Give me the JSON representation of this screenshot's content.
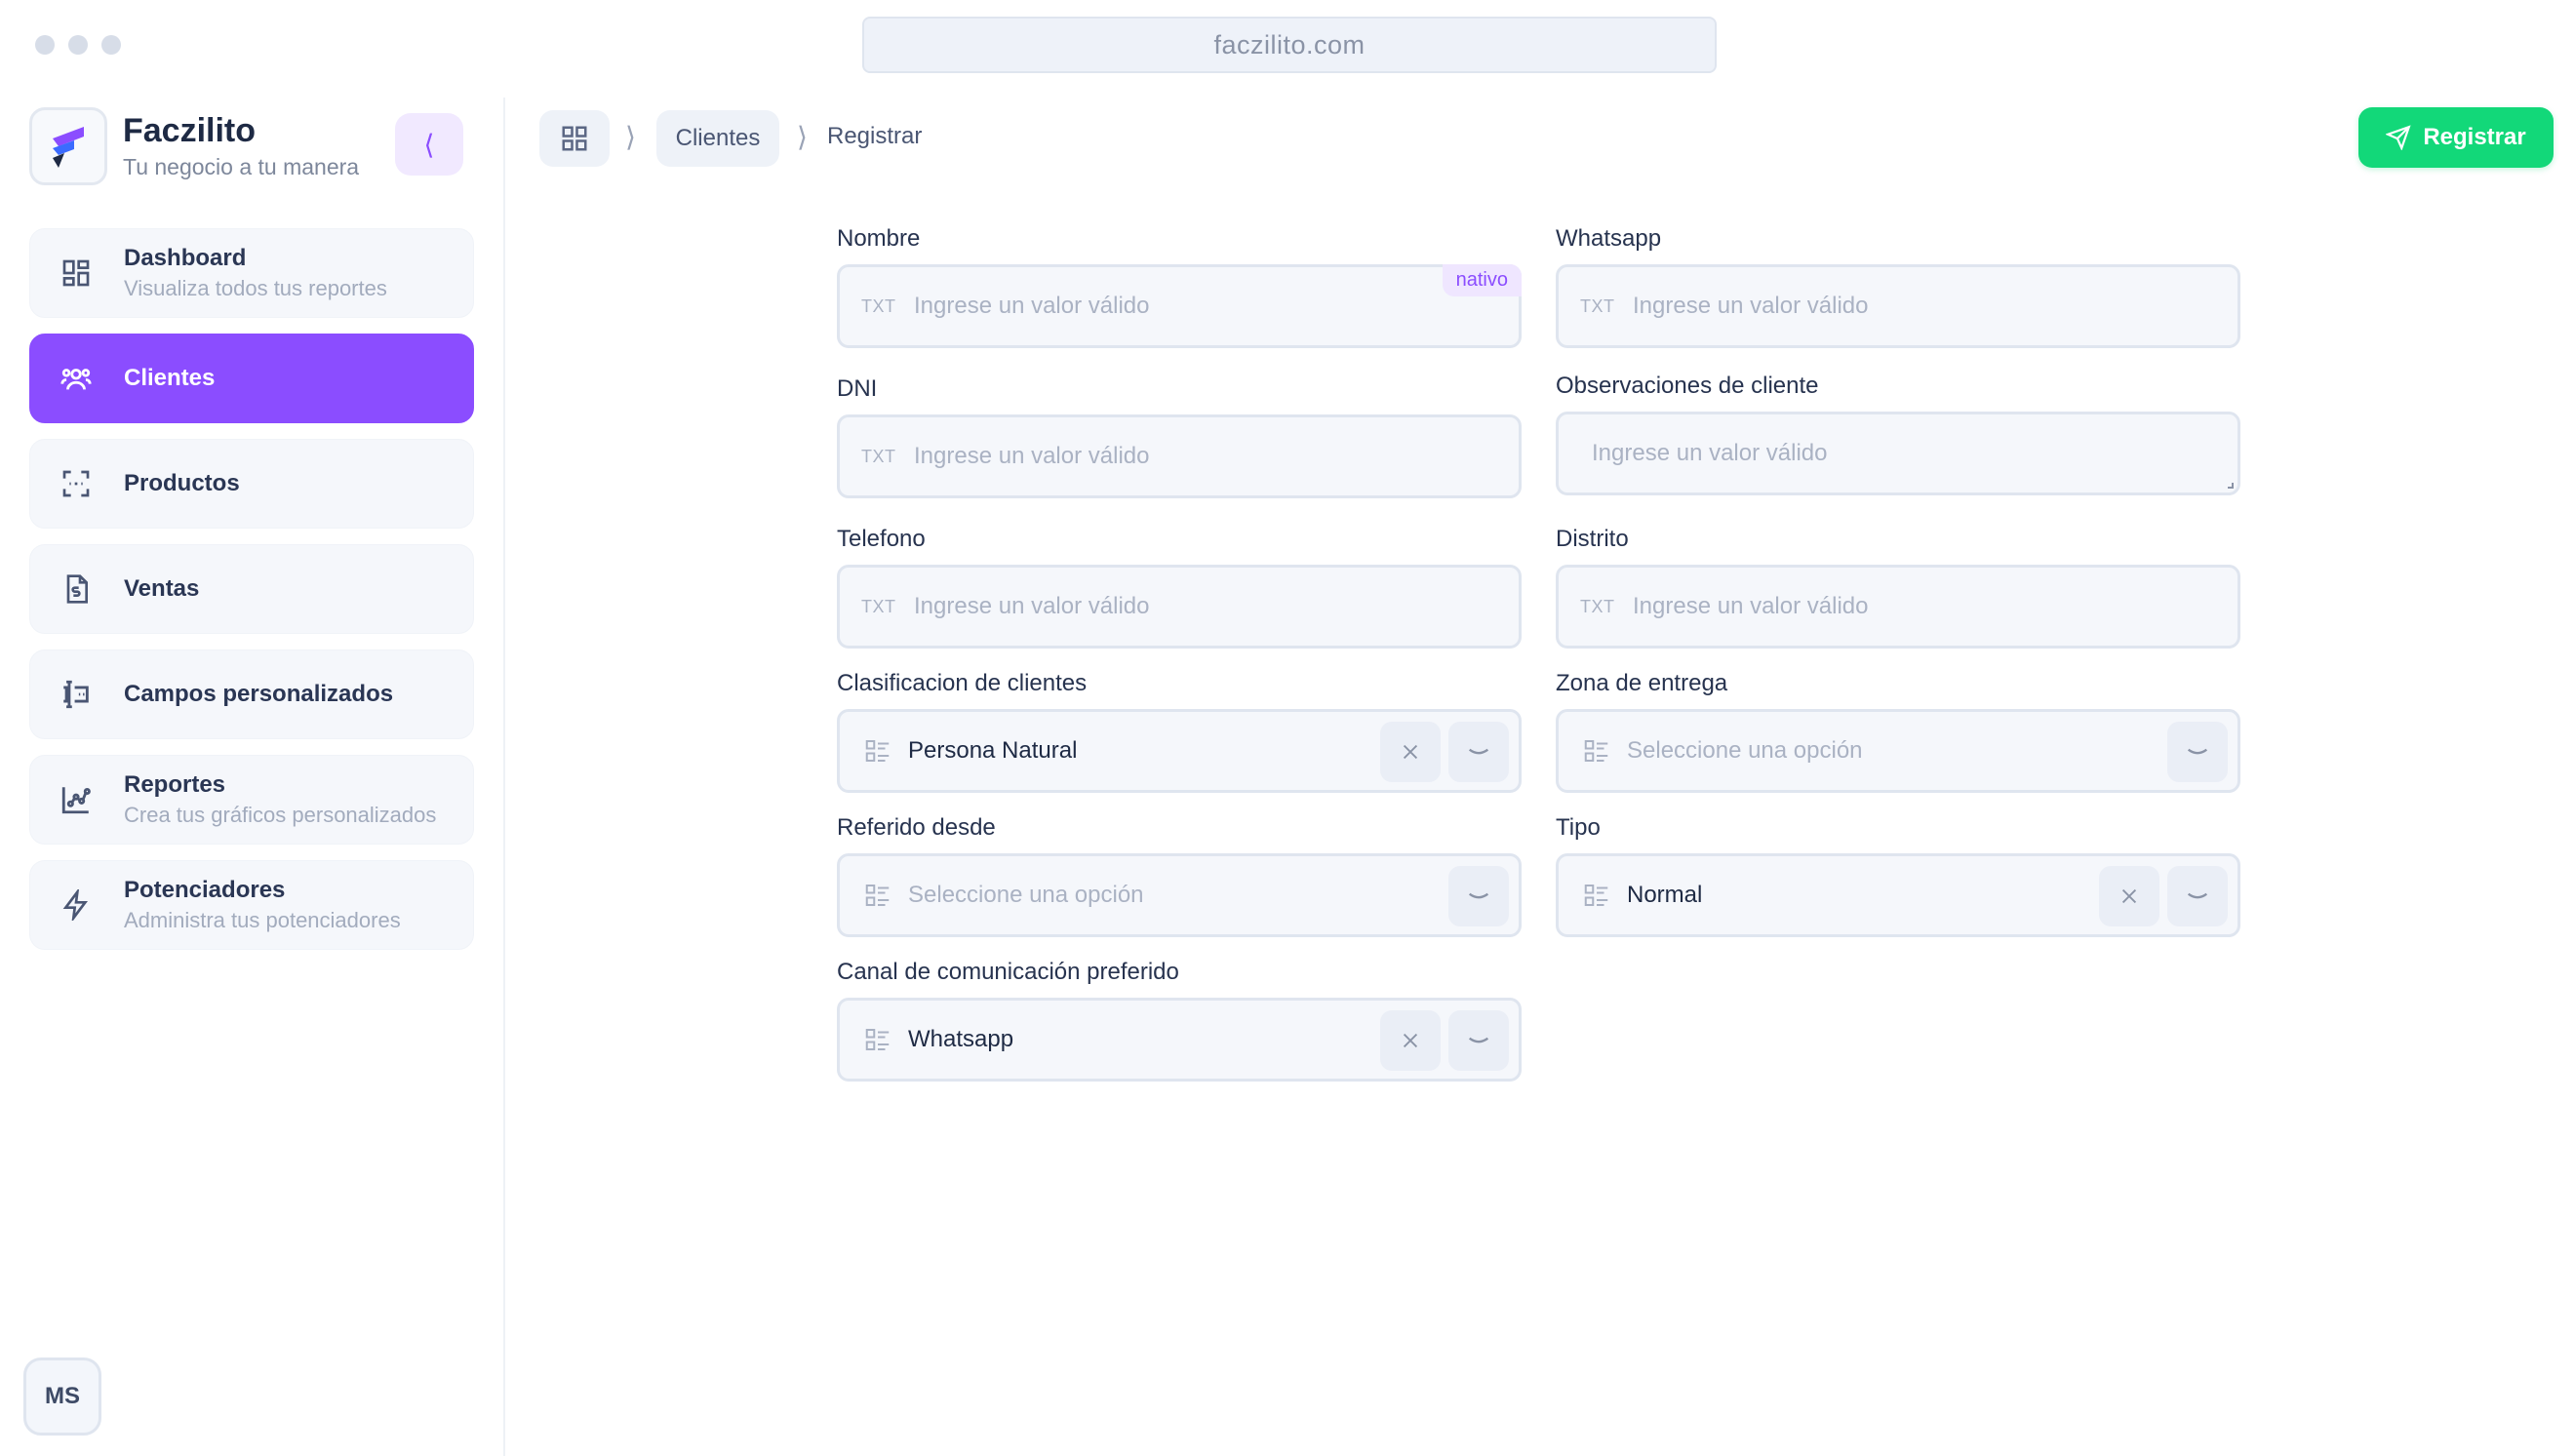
{
  "browser": {
    "url": "faczilito.com"
  },
  "brand": {
    "name": "Faczilito",
    "tagline": "Tu negocio a tu manera",
    "collapse_label": "⟨"
  },
  "sidebar": {
    "items": [
      {
        "label": "Dashboard",
        "sub": "Visualiza todos tus reportes",
        "icon": "dashboard-icon"
      },
      {
        "label": "Clientes",
        "sub": "",
        "icon": "users-icon",
        "active": true
      },
      {
        "label": "Productos",
        "sub": "",
        "icon": "scan-icon"
      },
      {
        "label": "Ventas",
        "sub": "",
        "icon": "invoice-icon"
      },
      {
        "label": "Campos personalizados",
        "sub": "",
        "icon": "custom-fields-icon"
      },
      {
        "label": "Reportes",
        "sub": "Crea tus gráficos personalizados",
        "icon": "chart-icon"
      },
      {
        "label": "Potenciadores",
        "sub": "Administra tus potenciadores",
        "icon": "bolt-icon"
      }
    ]
  },
  "user": {
    "initials": "MS"
  },
  "header": {
    "breadcrumb": {
      "sep": "⟩",
      "section": "Clientes",
      "current": "Registrar"
    },
    "primary_button": "Registrar"
  },
  "form": {
    "txt_badge": "TXT",
    "nombre": {
      "label": "Nombre",
      "placeholder": "Ingrese un valor válido",
      "badge": "nativo"
    },
    "whatsapp": {
      "label": "Whatsapp",
      "placeholder": "Ingrese un valor válido"
    },
    "dni": {
      "label": "DNI",
      "placeholder": "Ingrese un valor válido"
    },
    "observaciones": {
      "label": "Observaciones de cliente",
      "placeholder": "Ingrese un valor válido"
    },
    "telefono": {
      "label": "Telefono",
      "placeholder": "Ingrese un valor válido"
    },
    "distrito": {
      "label": "Distrito",
      "placeholder": "Ingrese un valor válido"
    },
    "clasificacion": {
      "label": "Clasificacion de clientes",
      "value": "Persona Natural"
    },
    "zona": {
      "label": "Zona de entrega",
      "placeholder": "Seleccione una opción"
    },
    "referido": {
      "label": "Referido desde",
      "placeholder": "Seleccione una opción"
    },
    "tipo": {
      "label": "Tipo",
      "value": "Normal"
    },
    "canal": {
      "label": "Canal de comunicación preferido",
      "value": "Whatsapp"
    }
  },
  "colors": {
    "accent": "#8b4dff",
    "primary_button": "#12d879"
  }
}
